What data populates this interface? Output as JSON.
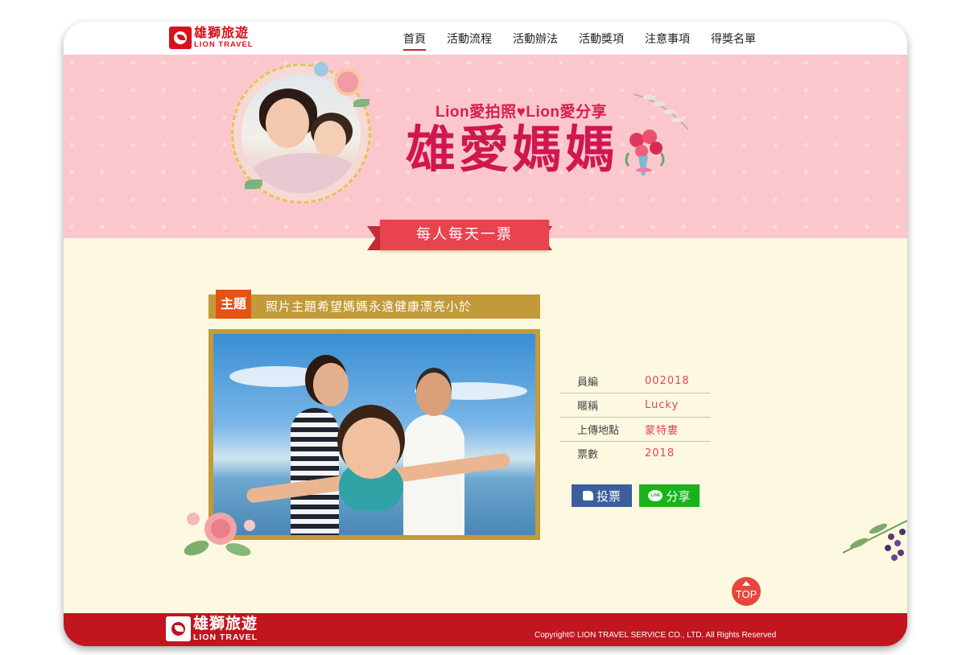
{
  "header": {
    "logo_cn": "雄獅旅遊",
    "logo_en": "LION TRAVEL",
    "nav": [
      "首頁",
      "活動流程",
      "活動辦法",
      "活動獎項",
      "注意事項",
      "得獎名單"
    ],
    "active_nav": "首頁"
  },
  "banner": {
    "subtitle": "Lion愛拍照♥Lion愛分享",
    "title": "雄愛媽媽",
    "ribbon": "每人每天一票"
  },
  "entry": {
    "theme_tag": "主題",
    "theme_text": "照片主題希望媽媽永遠健康漂亮小於",
    "info": [
      {
        "label": "員編",
        "value": "002018"
      },
      {
        "label": "暱稱",
        "value": "Lucky"
      },
      {
        "label": "上傳地點",
        "value": "蒙特婁"
      },
      {
        "label": "票數",
        "value": "2018"
      }
    ],
    "vote_label": "投票",
    "share_label": "分享",
    "line_icon_text": "LINE"
  },
  "top_button": "TOP",
  "footer": {
    "logo_cn": "雄獅旅遊",
    "logo_en": "LION TRAVEL",
    "copyright": "Copyright© LION TRAVEL SERVICE CO., LTD. All Rights Reserved"
  },
  "colors": {
    "brand_red": "#d6121d",
    "banner_pink": "#fbc7cc",
    "content_bg": "#fdf9e1",
    "gold": "#c39a39",
    "tag_orange": "#e35315",
    "vote_blue": "#3b5e9e",
    "share_green": "#19b31b"
  }
}
